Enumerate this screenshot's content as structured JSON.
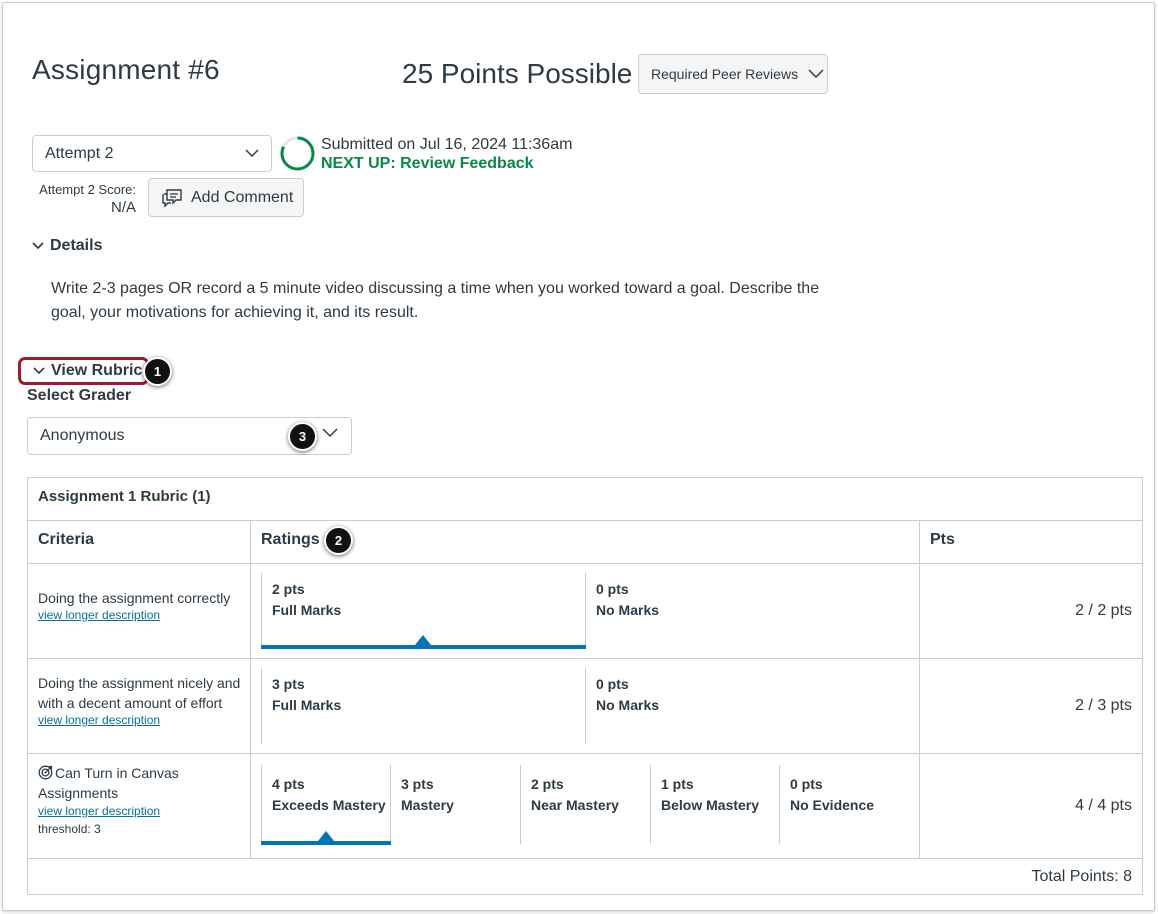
{
  "assignment": {
    "title": "Assignment #6",
    "points_possible": "25 Points Possible",
    "peer_review_button": "Required Peer Reviews"
  },
  "attempt": {
    "selected": "Attempt 2",
    "submitted_text": "Submitted on Jul 16, 2024 11:36am",
    "next_up": "NEXT UP: Review Feedback",
    "score_label": "Attempt 2 Score:",
    "score_value": "N/A",
    "add_comment": "Add Comment"
  },
  "details": {
    "toggle_label": "Details",
    "description": "Write 2-3 pages OR record a 5 minute video discussing a time when you worked toward a goal. Describe the goal, your motivations for achieving it, and its result."
  },
  "rubric_controls": {
    "view_rubric": "View Rubric",
    "select_grader_label": "Select Grader",
    "grader_selected": "Anonymous",
    "callouts": [
      "1",
      "2",
      "3"
    ]
  },
  "rubric": {
    "title": "Assignment 1 Rubric (1)",
    "headers": {
      "criteria": "Criteria",
      "ratings": "Ratings",
      "pts": "Pts"
    },
    "rows": [
      {
        "criterion": "Doing the assignment correctly",
        "link": "view longer description",
        "ratings": [
          {
            "pts": "2 pts",
            "label": "Full Marks",
            "selected": true
          },
          {
            "pts": "0 pts",
            "label": "No Marks",
            "selected": false
          }
        ],
        "score": "2 / 2 pts"
      },
      {
        "criterion": "Doing the assignment nicely and with a decent amount of effort",
        "link": "view longer description",
        "ratings": [
          {
            "pts": "3 pts",
            "label": "Full Marks",
            "selected": false
          },
          {
            "pts": "0 pts",
            "label": "No Marks",
            "selected": false
          }
        ],
        "score": "2 / 3 pts"
      },
      {
        "criterion": "Can Turn in Canvas Assignments",
        "icon": "outcome-target-icon",
        "link": "view longer description",
        "threshold": "threshold: 3",
        "ratings": [
          {
            "pts": "4 pts",
            "label": "Exceeds Mastery",
            "selected": true
          },
          {
            "pts": "3 pts",
            "label": "Mastery",
            "selected": false
          },
          {
            "pts": "2 pts",
            "label": "Near Mastery",
            "selected": false
          },
          {
            "pts": "1 pts",
            "label": "Below Mastery",
            "selected": false
          },
          {
            "pts": "0 pts",
            "label": "No Evidence",
            "selected": false
          }
        ],
        "score": "4 / 4 pts"
      }
    ],
    "total": "Total Points: 8"
  },
  "colors": {
    "accent": "#0374b5",
    "success": "#0b874b",
    "highlight_border": "#9e1c2a",
    "link": "#0770a3"
  }
}
